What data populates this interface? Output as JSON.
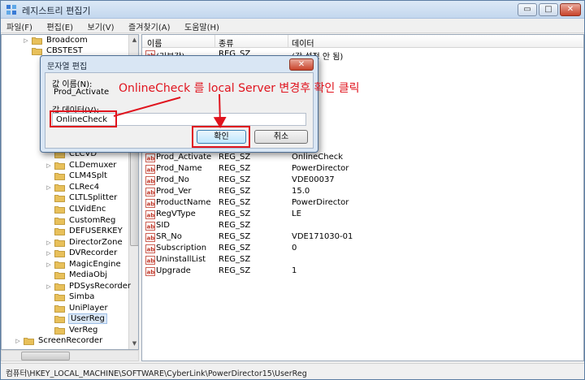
{
  "window": {
    "title": "레지스트리 편집기",
    "btn_min": "▭",
    "btn_max": "□",
    "btn_close": "✕"
  },
  "menu": [
    "파일(F)",
    "편집(E)",
    "보기(V)",
    "즐겨찾기(A)",
    "도움말(H)"
  ],
  "tree": {
    "items": [
      {
        "label": "Broadcom",
        "expander": "▷"
      },
      {
        "label": "CBSTEST",
        "expander": ""
      },
      {
        "label": "CLCVD",
        "expander": ""
      },
      {
        "label": "CLDemuxer",
        "expander": "▷"
      },
      {
        "label": "CLM4Splt",
        "expander": ""
      },
      {
        "label": "CLRec4",
        "expander": "▷"
      },
      {
        "label": "CLTLSplitter",
        "expander": ""
      },
      {
        "label": "CLVidEnc",
        "expander": ""
      },
      {
        "label": "CustomReg",
        "expander": ""
      },
      {
        "label": "DEFUSERKEY",
        "expander": ""
      },
      {
        "label": "DirectorZone",
        "expander": "▷"
      },
      {
        "label": "DVRecorder",
        "expander": "▷"
      },
      {
        "label": "MagicEngine",
        "expander": "▷"
      },
      {
        "label": "MediaObj",
        "expander": ""
      },
      {
        "label": "PDSysRecorder",
        "expander": "▷"
      },
      {
        "label": "Simba",
        "expander": ""
      },
      {
        "label": "UniPlayer",
        "expander": ""
      },
      {
        "label": "UserReg",
        "expander": ""
      },
      {
        "label": "VerReg",
        "expander": ""
      },
      {
        "label": "ScreenRecorder",
        "expander": "▷"
      }
    ]
  },
  "list": {
    "columns": {
      "name": "이름",
      "type": "종류",
      "data": "데이터"
    },
    "rows": [
      {
        "name": "(기본값)",
        "type": "REG_SZ",
        "data": "(값 설정 안 됨)"
      },
      {
        "name": "",
        "type": "",
        "data": "irector"
      },
      {
        "name": "Prod_Activate",
        "type": "REG_SZ",
        "data": "OnlineCheck"
      },
      {
        "name": "Prod_Name",
        "type": "REG_SZ",
        "data": "PowerDirector"
      },
      {
        "name": "Prod_No",
        "type": "REG_SZ",
        "data": "VDE00037"
      },
      {
        "name": "Prod_Ver",
        "type": "REG_SZ",
        "data": "15.0"
      },
      {
        "name": "ProductName",
        "type": "REG_SZ",
        "data": "PowerDirector"
      },
      {
        "name": "RegVType",
        "type": "REG_SZ",
        "data": "LE"
      },
      {
        "name": "SID",
        "type": "REG_SZ",
        "data": ""
      },
      {
        "name": "SR_No",
        "type": "REG_SZ",
        "data": "VDE171030-01"
      },
      {
        "name": "Subscription",
        "type": "REG_SZ",
        "data": "0"
      },
      {
        "name": "UninstallList",
        "type": "REG_SZ",
        "data": ""
      },
      {
        "name": "Upgrade",
        "type": "REG_SZ",
        "data": "1"
      }
    ]
  },
  "status": "컴퓨터\\HKEY_LOCAL_MACHINE\\SOFTWARE\\CyberLink\\PowerDirector15\\UserReg",
  "dialog": {
    "title": "문자열 편집",
    "close_label": "✕",
    "value_name_label": "값 이름(N):",
    "value_name": "Prod_Activate",
    "value_data_label": "값 데이터(V):",
    "value_data": "OnlineCheck",
    "ok_label": "확인",
    "cancel_label": "취소"
  },
  "annotation": "OnlineCheck 를 local Server 변경후 확인 클릭",
  "colors": {
    "annotation": "#e0141e",
    "folder": "#e8c05a",
    "selection": "#dbe8f7"
  },
  "icons": {
    "tree_folder": "folder-icon",
    "value": "string-value-icon",
    "app": "registry-editor-icon"
  }
}
